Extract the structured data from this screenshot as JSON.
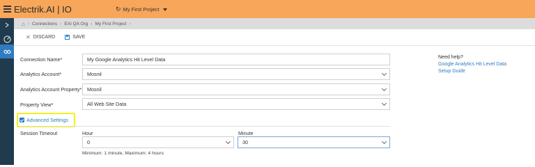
{
  "app": {
    "title": "Electrik.AI | IO",
    "project": "My First Project"
  },
  "breadcrumb": [
    "Connections",
    "EAI QA Org",
    "My First Project"
  ],
  "toolbar": {
    "discard_label": "DISCARD",
    "save_label": "SAVE"
  },
  "form": {
    "connection_name": {
      "label": "Connection Name*",
      "value": "My Google Analytics Hit Level Data"
    },
    "analytics_account": {
      "label": "Analytics Account*",
      "value": "Mosnil"
    },
    "analytics_property": {
      "label": "Analytics Account Property*",
      "value": "Mosnil"
    },
    "property_view": {
      "label": "Property View*",
      "value": "All Web Site Data"
    },
    "advanced_settings": {
      "label": "Advanced Settings",
      "checked": true
    },
    "session_timeout": {
      "label": "Session Timeout",
      "hour_label": "Hour",
      "hour_value": "0",
      "minute_label": "Minute",
      "minute_value": "30",
      "hint": "Minimum: 1 minute, Maximum: 4 hours"
    }
  },
  "help": {
    "heading": "Need help?",
    "link_line1": "Google Analytics Hit Level Data",
    "link_line2": "Setup Guide"
  },
  "colors": {
    "topbar": "#f7a65a",
    "sidebar": "#1f3b4d",
    "accent": "#2e7bc0",
    "highlight": "#f2f21c"
  }
}
